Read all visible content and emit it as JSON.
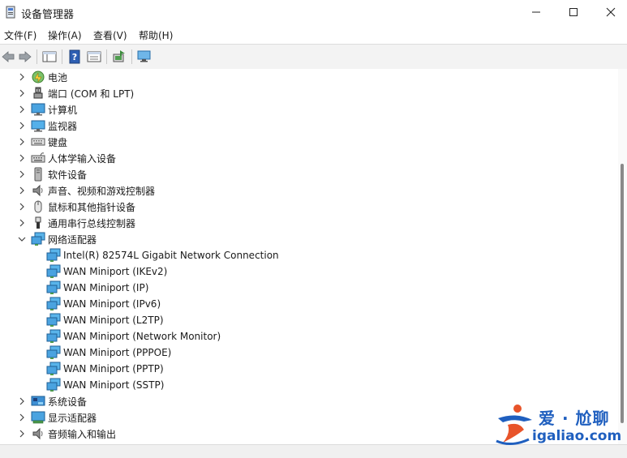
{
  "window": {
    "title": "设备管理器"
  },
  "menu": [
    "文件(F)",
    "操作(A)",
    "查看(V)",
    "帮助(H)"
  ],
  "tree": [
    {
      "label": "电池",
      "icon": "battery-icon",
      "expanded": false
    },
    {
      "label": "端口 (COM 和 LPT)",
      "icon": "port-icon",
      "expanded": false
    },
    {
      "label": "计算机",
      "icon": "computer-icon",
      "expanded": false
    },
    {
      "label": "监视器",
      "icon": "monitor-icon",
      "expanded": false
    },
    {
      "label": "键盘",
      "icon": "keyboard-icon",
      "expanded": false
    },
    {
      "label": "人体学输入设备",
      "icon": "hid-icon",
      "expanded": false
    },
    {
      "label": "软件设备",
      "icon": "software-device-icon",
      "expanded": false
    },
    {
      "label": "声音、视频和游戏控制器",
      "icon": "speaker-icon",
      "expanded": false
    },
    {
      "label": "鼠标和其他指针设备",
      "icon": "mouse-icon",
      "expanded": false
    },
    {
      "label": "通用串行总线控制器",
      "icon": "usb-icon",
      "expanded": false
    },
    {
      "label": "网络适配器",
      "icon": "network-adapter-icon",
      "expanded": true,
      "children": [
        "Intel(R) 82574L Gigabit Network Connection",
        "WAN Miniport (IKEv2)",
        "WAN Miniport (IP)",
        "WAN Miniport (IPv6)",
        "WAN Miniport (L2TP)",
        "WAN Miniport (Network Monitor)",
        "WAN Miniport (PPPOE)",
        "WAN Miniport (PPTP)",
        "WAN Miniport (SSTP)"
      ]
    },
    {
      "label": "系统设备",
      "icon": "system-device-icon",
      "expanded": false
    },
    {
      "label": "显示适配器",
      "icon": "display-adapter-icon",
      "expanded": false
    },
    {
      "label": "音频输入和输出",
      "icon": "audio-io-icon",
      "expanded": false
    }
  ],
  "watermark": {
    "cn": "爱 · 尬聊",
    "en": "igaliao.com"
  }
}
